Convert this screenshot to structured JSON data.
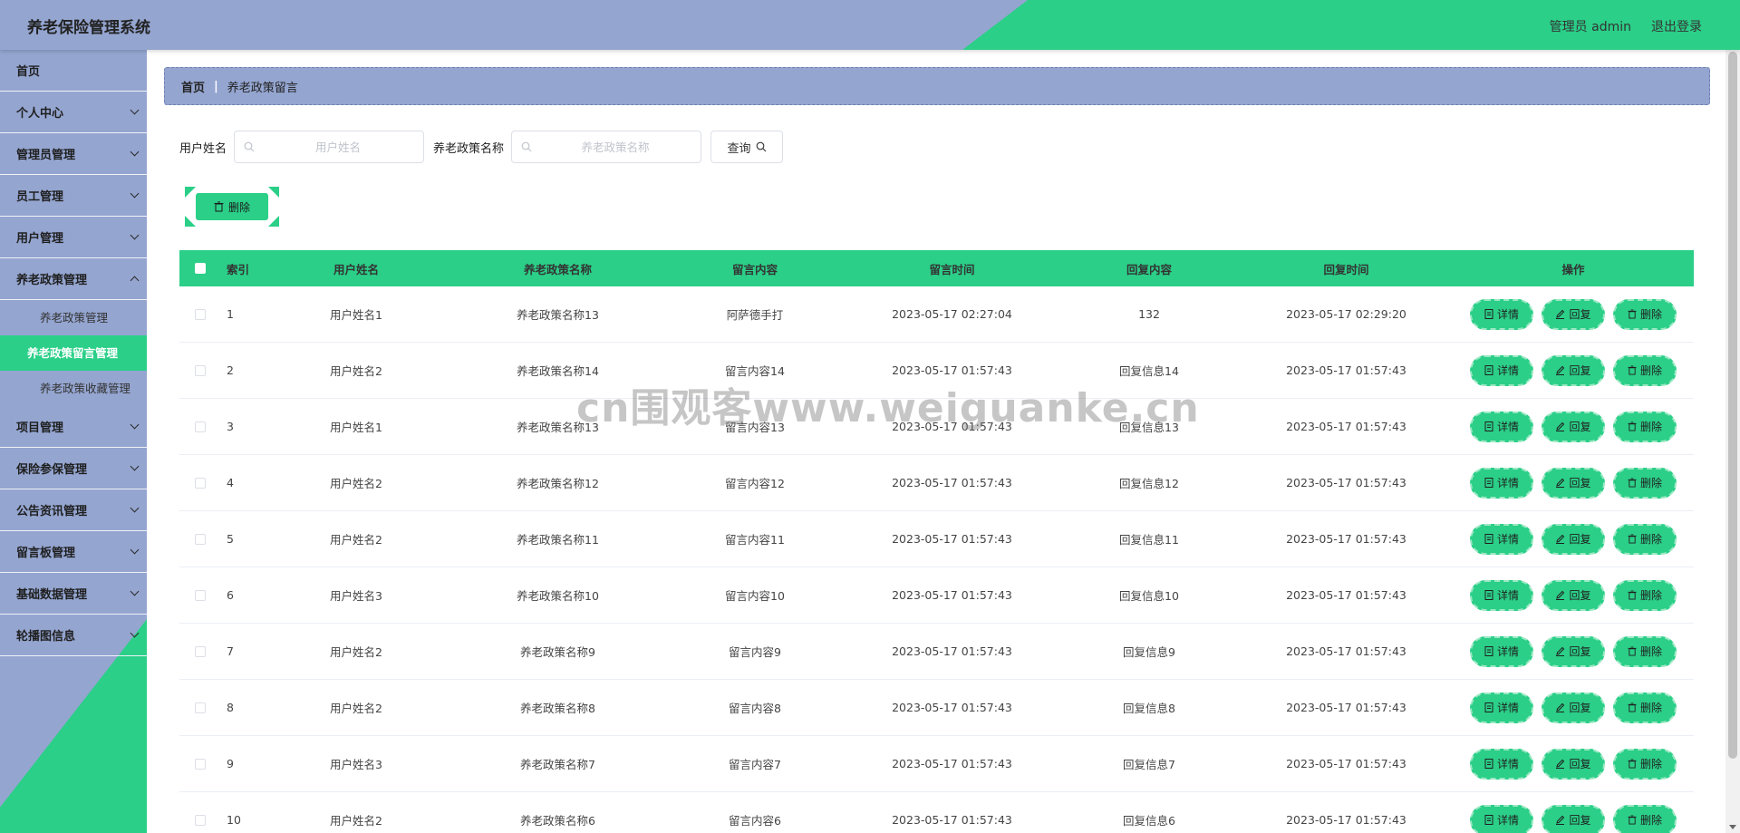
{
  "header": {
    "title": "养老保险管理系统",
    "user": "管理员 admin",
    "logout": "退出登录",
    "bg_color": "#94a5d0",
    "accent_color": "#2bcf88"
  },
  "sidebar": {
    "items": [
      {
        "label": "首页",
        "has_children": false
      },
      {
        "label": "个人中心",
        "has_children": true
      },
      {
        "label": "管理员管理",
        "has_children": true
      },
      {
        "label": "员工管理",
        "has_children": true
      },
      {
        "label": "用户管理",
        "has_children": true
      },
      {
        "label": "养老政策管理",
        "has_children": true,
        "open": true,
        "children": [
          {
            "label": "养老政策管理",
            "active": false
          },
          {
            "label": "养老政策留言管理",
            "active": true
          },
          {
            "label": "养老政策收藏管理",
            "active": false
          }
        ]
      },
      {
        "label": "项目管理",
        "has_children": true
      },
      {
        "label": "保险参保管理",
        "has_children": true
      },
      {
        "label": "公告资讯管理",
        "has_children": true
      },
      {
        "label": "留言板管理",
        "has_children": true
      },
      {
        "label": "基础数据管理",
        "has_children": true
      },
      {
        "label": "轮播图信息",
        "has_children": true
      }
    ]
  },
  "breadcrumb": {
    "home": "首页",
    "separator": "|",
    "current": "养老政策留言"
  },
  "search": {
    "username_label": "用户姓名",
    "username_placeholder": "用户姓名",
    "policy_label": "养老政策名称",
    "policy_placeholder": "养老政策名称",
    "query_label": "查询"
  },
  "actions": {
    "bulk_delete_label": "删除"
  },
  "table": {
    "columns": [
      "索引",
      "用户姓名",
      "养老政策名称",
      "留言内容",
      "留言时间",
      "回复内容",
      "回复时间",
      "操作"
    ],
    "row_actions": {
      "detail": "详情",
      "reply": "回复",
      "delete": "删除"
    },
    "rows": [
      {
        "index": "1",
        "user": "用户姓名1",
        "policy": "养老政策名称13",
        "message": "阿萨德手打",
        "msg_time": "2023-05-17 02:27:04",
        "reply": "132",
        "reply_time": "2023-05-17 02:29:20"
      },
      {
        "index": "2",
        "user": "用户姓名2",
        "policy": "养老政策名称14",
        "message": "留言内容14",
        "msg_time": "2023-05-17 01:57:43",
        "reply": "回复信息14",
        "reply_time": "2023-05-17 01:57:43"
      },
      {
        "index": "3",
        "user": "用户姓名1",
        "policy": "养老政策名称13",
        "message": "留言内容13",
        "msg_time": "2023-05-17 01:57:43",
        "reply": "回复信息13",
        "reply_time": "2023-05-17 01:57:43"
      },
      {
        "index": "4",
        "user": "用户姓名2",
        "policy": "养老政策名称12",
        "message": "留言内容12",
        "msg_time": "2023-05-17 01:57:43",
        "reply": "回复信息12",
        "reply_time": "2023-05-17 01:57:43"
      },
      {
        "index": "5",
        "user": "用户姓名2",
        "policy": "养老政策名称11",
        "message": "留言内容11",
        "msg_time": "2023-05-17 01:57:43",
        "reply": "回复信息11",
        "reply_time": "2023-05-17 01:57:43"
      },
      {
        "index": "6",
        "user": "用户姓名3",
        "policy": "养老政策名称10",
        "message": "留言内容10",
        "msg_time": "2023-05-17 01:57:43",
        "reply": "回复信息10",
        "reply_time": "2023-05-17 01:57:43"
      },
      {
        "index": "7",
        "user": "用户姓名2",
        "policy": "养老政策名称9",
        "message": "留言内容9",
        "msg_time": "2023-05-17 01:57:43",
        "reply": "回复信息9",
        "reply_time": "2023-05-17 01:57:43"
      },
      {
        "index": "8",
        "user": "用户姓名2",
        "policy": "养老政策名称8",
        "message": "留言内容8",
        "msg_time": "2023-05-17 01:57:43",
        "reply": "回复信息8",
        "reply_time": "2023-05-17 01:57:43"
      },
      {
        "index": "9",
        "user": "用户姓名3",
        "policy": "养老政策名称7",
        "message": "留言内容7",
        "msg_time": "2023-05-17 01:57:43",
        "reply": "回复信息7",
        "reply_time": "2023-05-17 01:57:43"
      },
      {
        "index": "10",
        "user": "用户姓名2",
        "policy": "养老政策名称6",
        "message": "留言内容6",
        "msg_time": "2023-05-17 01:57:43",
        "reply": "回复信息6",
        "reply_time": "2023-05-17 01:57:43"
      }
    ]
  },
  "watermark": "cn围观客www.weiguanke.cn",
  "icons": {
    "search": "search-icon",
    "delete": "trash-icon",
    "detail": "document-icon",
    "reply": "edit-icon",
    "expand": "chevron-down-icon"
  }
}
